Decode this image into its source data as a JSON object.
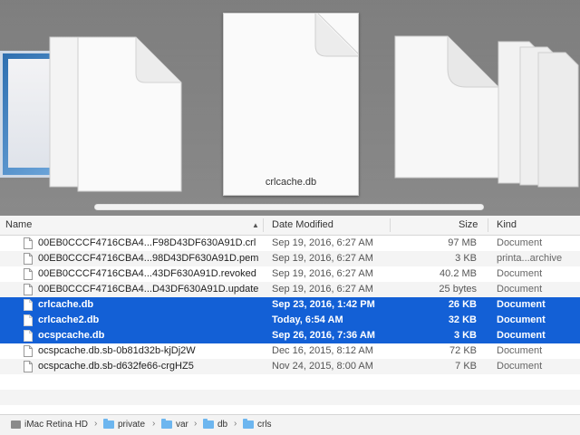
{
  "coverflow": {
    "center_label": "crlcache.db"
  },
  "columns": {
    "name": "Name",
    "date": "Date Modified",
    "size": "Size",
    "kind": "Kind"
  },
  "rows": [
    {
      "name": "00EB0CCCF4716CBA4...F98D43DF630A91D.crl",
      "date": "Sep 19, 2016, 6:27 AM",
      "size": "97 MB",
      "kind": "Document",
      "selected": false
    },
    {
      "name": "00EB0CCCF4716CBA4...98D43DF630A91D.pem",
      "date": "Sep 19, 2016, 6:27 AM",
      "size": "3 KB",
      "kind": "printa...archive",
      "selected": false
    },
    {
      "name": "00EB0CCCF4716CBA4...43DF630A91D.revoked",
      "date": "Sep 19, 2016, 6:27 AM",
      "size": "40.2 MB",
      "kind": "Document",
      "selected": false
    },
    {
      "name": "00EB0CCCF4716CBA4...D43DF630A91D.update",
      "date": "Sep 19, 2016, 6:27 AM",
      "size": "25 bytes",
      "kind": "Document",
      "selected": false
    },
    {
      "name": "crlcache.db",
      "date": "Sep 23, 2016, 1:42 PM",
      "size": "26 KB",
      "kind": "Document",
      "selected": true
    },
    {
      "name": "crlcache2.db",
      "date": "Today, 6:54 AM",
      "size": "32 KB",
      "kind": "Document",
      "selected": true
    },
    {
      "name": "ocspcache.db",
      "date": "Sep 26, 2016, 7:36 AM",
      "size": "3 KB",
      "kind": "Document",
      "selected": true
    },
    {
      "name": "ocspcache.db.sb-0b81d32b-kjDj2W",
      "date": "Dec 16, 2015, 8:12 AM",
      "size": "72 KB",
      "kind": "Document",
      "selected": false
    },
    {
      "name": "ocspcache.db.sb-d632fe66-crgHZ5",
      "date": "Nov 24, 2015, 8:00 AM",
      "size": "7 KB",
      "kind": "Document",
      "selected": false
    }
  ],
  "pathbar": {
    "items": [
      "iMac Retina HD",
      "private",
      "var",
      "db",
      "crls"
    ]
  },
  "colors": {
    "selection": "#1360d6",
    "folder": "#6db6ef"
  }
}
